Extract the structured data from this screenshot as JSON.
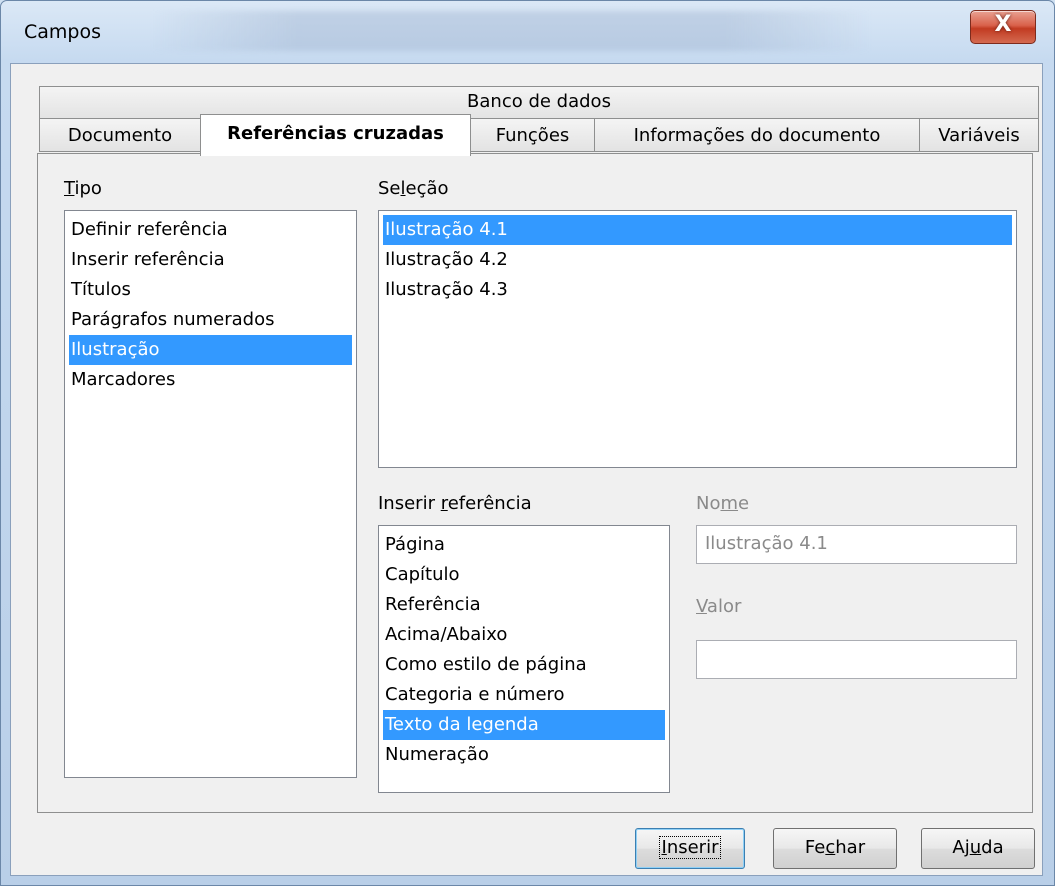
{
  "window": {
    "title": "Campos",
    "close_glyph": "X"
  },
  "tabs": {
    "row1": [
      "Banco de dados"
    ],
    "row2": [
      "Documento",
      "Referências cruzadas",
      "Funções",
      "Informações do documento",
      "Variáveis"
    ],
    "active": "Referências cruzadas"
  },
  "tipo": {
    "label_prefix": "",
    "label_mnemonic": "T",
    "label_rest": "ipo",
    "items": [
      "Definir referência",
      "Inserir referência",
      "Títulos",
      "Parágrafos numerados",
      "Ilustração",
      "Marcadores"
    ],
    "selected_index": 4
  },
  "selecao": {
    "label_prefix": "Se",
    "label_mnemonic": "l",
    "label_rest": "eção",
    "items": [
      "Ilustração 4.1",
      "Ilustração 4.2",
      "Ilustração 4.3"
    ],
    "selected_index": 0
  },
  "inserir_referencia": {
    "label_prefix": "Inserir ",
    "label_mnemonic": "r",
    "label_rest": "eferência",
    "items": [
      "Página",
      "Capítulo",
      "Referência",
      "Acima/Abaixo",
      "Como estilo de página",
      "Categoria e número",
      "Texto da legenda",
      "Numeração"
    ],
    "selected_index": 6
  },
  "nome": {
    "label_prefix": "No",
    "label_mnemonic": "m",
    "label_rest": "e",
    "value": "Ilustração 4.1"
  },
  "valor": {
    "label_prefix": "",
    "label_mnemonic": "V",
    "label_rest": "alor",
    "value": ""
  },
  "buttons": {
    "inserir": {
      "prefix": "",
      "mnemonic": "I",
      "rest": "nserir"
    },
    "fechar": {
      "prefix": "Fe",
      "mnemonic": "c",
      "rest": "har"
    },
    "ajuda": {
      "prefix": "Aj",
      "mnemonic": "u",
      "rest": "da"
    }
  },
  "colors": {
    "selection": "#3399ff",
    "close_button": "#c23b22"
  }
}
